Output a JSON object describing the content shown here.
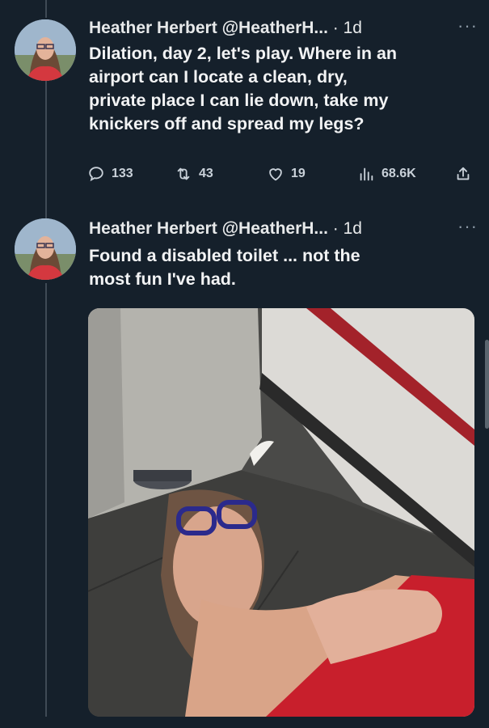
{
  "tweets": [
    {
      "author_name": "Heather Herbert",
      "handle": "@HeatherH...",
      "separator": "·",
      "time": "1d",
      "more": "···",
      "text_lines": [
        "Dilation, day 2, let's play. Where in an",
        "airport can I locate a clean, dry,",
        "private place I can lie down, take my",
        "knickers off and spread my legs?"
      ],
      "actions": {
        "replies": "133",
        "retweets": "43",
        "likes": "19",
        "views": "68.6K"
      }
    },
    {
      "author_name": "Heather Herbert",
      "handle": "@HeatherH...",
      "separator": "·",
      "time": "1d",
      "more": "···",
      "text_lines": [
        "Found a disabled toilet ... not the",
        "most fun I've had."
      ]
    }
  ],
  "colors": {
    "background": "#15202b",
    "text": "#e7e9ea",
    "secondary": "#8b98a5"
  }
}
